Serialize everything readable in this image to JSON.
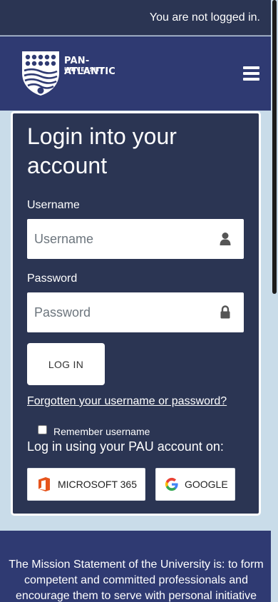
{
  "topbar": {
    "status_text": "You are not logged in."
  },
  "brand": {
    "name_line1": "PAN-ATLANTIC",
    "name_line2": "UNIVERSITY",
    "menu_icon": "hamburger-menu-icon"
  },
  "login": {
    "heading": "Login into your account",
    "username_label": "Username",
    "username_placeholder": "Username",
    "username_value": "",
    "username_icon": "user-icon",
    "password_label": "Password",
    "password_placeholder": "Password",
    "password_value": "",
    "password_icon": "lock-icon",
    "login_button": "LOG IN",
    "forgot_link": "Forgotten your username or password?",
    "remember_label": "Remember username",
    "remember_checked": false,
    "sso_prompt": "Log in using your PAU account on:",
    "sso_providers": [
      {
        "label": "MICROSOFT 365",
        "icon": "office-365-icon",
        "color": "#e6541c"
      },
      {
        "label": "GOOGLE",
        "icon": "google-icon",
        "color": "#4285f4"
      }
    ]
  },
  "footer": {
    "mission_text": "The Mission Statement of the University is: to form competent and committed professionals and encourage them to serve with personal initiative"
  },
  "colors": {
    "topbar_bg": "#2b3553",
    "brand_bg": "#2f3a72",
    "card_bg": "#2b3553",
    "page_bg": "#c9dce9"
  }
}
